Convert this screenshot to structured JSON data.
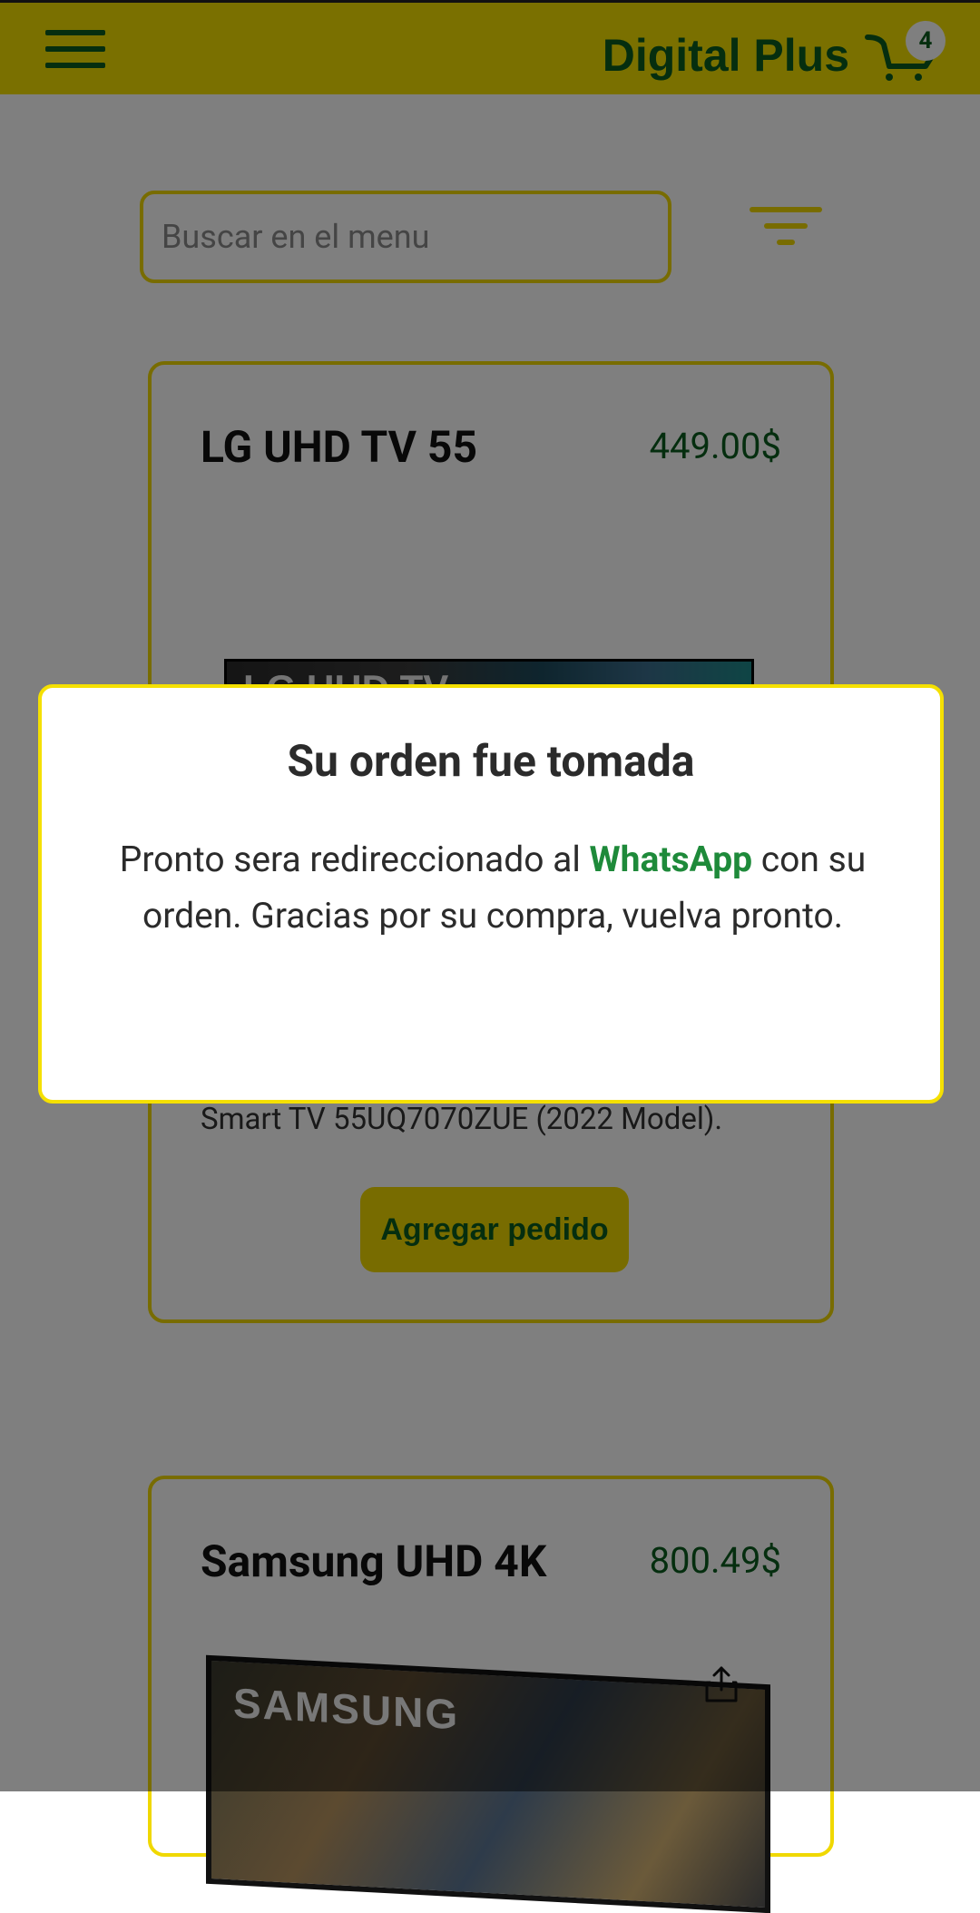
{
  "header": {
    "brand": "Digital Plus",
    "cart_count": "4"
  },
  "search": {
    "placeholder": "Buscar en el menu"
  },
  "products": [
    {
      "name": "LG UHD TV 55",
      "price": "449.00$",
      "image_label": "LG UHD TV",
      "description_visible": "Smart TV 55UQ7070ZUE (2022 Model).",
      "button_label": "Agregar pedido"
    },
    {
      "name": "Samsung UHD 4K",
      "price": "800.49$",
      "image_label": "SAMSUNG"
    }
  ],
  "modal": {
    "title": "Su orden fue tomada",
    "message_before": "Pronto sera redireccionado al ",
    "message_highlight": "WhatsApp",
    "message_after": " con su orden. Gracias por su compra, vuelva pronto."
  },
  "colors": {
    "brand_yellow": "#f5e000",
    "brand_green": "#0b5d1e",
    "whatsapp_green": "#1e8a3a",
    "overlay": "rgba(0,0,0,0.5)"
  },
  "icons": {
    "menu": "hamburger-menu-icon",
    "cart": "shopping-cart-icon",
    "filter": "filter-icon",
    "share": "share-icon"
  }
}
